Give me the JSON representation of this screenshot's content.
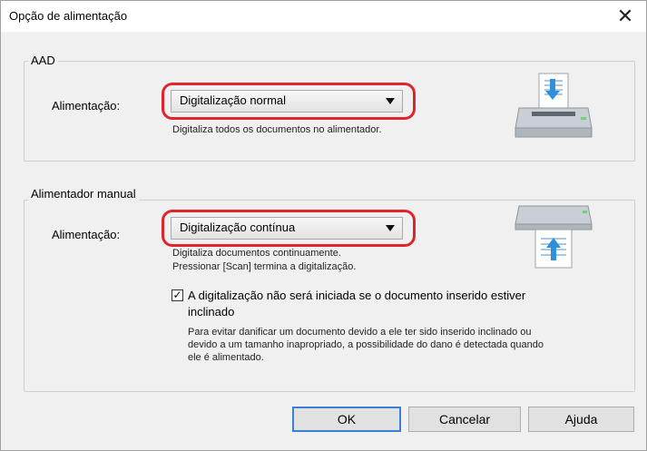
{
  "window": {
    "title": "Opção de alimentação",
    "close_icon": "close-icon"
  },
  "aad": {
    "group_label": "AAD",
    "field_label": "Alimentação:",
    "selected": "Digitalização normal",
    "description": "Digitaliza todos os documentos no alimentador.",
    "icon": "scanner-feed-down-icon"
  },
  "manual": {
    "group_label": "Alimentador manual",
    "field_label": "Alimentação:",
    "selected": "Digitalização contínua",
    "description_line1": "Digitaliza documentos continuamente.",
    "description_line2": "Pressionar [Scan] termina a digitalização.",
    "icon": "scanner-feed-up-icon",
    "checkbox_checked": true,
    "checkbox_label_line1": "A digitalização não será iniciada se o documento inserido estiver",
    "checkbox_label_line2": "inclinado",
    "note_line1": "Para evitar danificar um documento devido a ele ter sido inserido inclinado ou",
    "note_line2": "devido a um tamanho inapropriado, a possibilidade do dano é detectada quando",
    "note_line3": "ele é alimentado."
  },
  "buttons": {
    "ok": "OK",
    "cancel": "Cancelar",
    "help": "Ajuda"
  },
  "colors": {
    "highlight": "#e0242b",
    "default_button_border": "#3c7fd6",
    "dialog_bg": "#f0f0f0"
  }
}
